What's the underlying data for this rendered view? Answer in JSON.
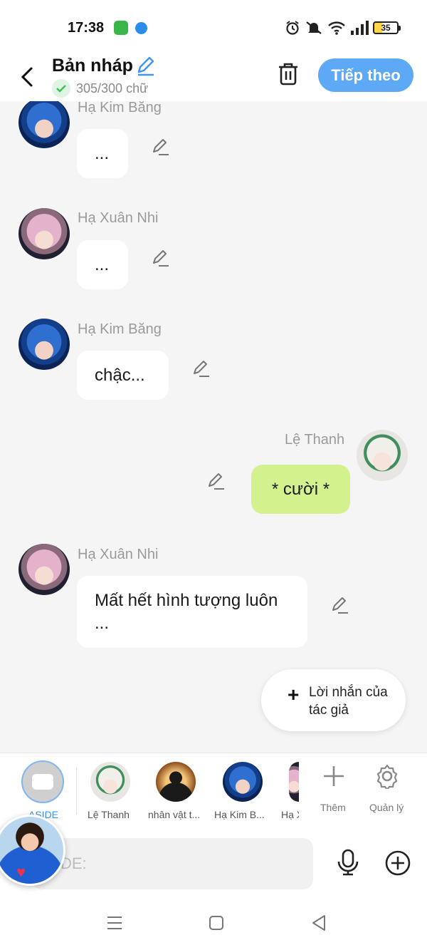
{
  "status_bar": {
    "time": "17:38",
    "battery": "35"
  },
  "header": {
    "title": "Bản nháp",
    "word_count": "305/300 chữ",
    "next_label": "Tiếp theo"
  },
  "messages": [
    {
      "sender": "Hạ Kim Băng",
      "text": "...",
      "side": "left",
      "avatar": "blue-hair-girl"
    },
    {
      "sender": "Hạ Xuân Nhi",
      "text": "...",
      "side": "left",
      "avatar": "pink-hair-girl"
    },
    {
      "sender": "Hạ Kim Băng",
      "text": "chậc...",
      "side": "left",
      "avatar": "blue-hair-girl"
    },
    {
      "sender": "Lệ Thanh",
      "text": "* cười *",
      "side": "right",
      "avatar": "white-hair-girl"
    },
    {
      "sender": "Hạ Xuân Nhi",
      "text": "Mất hết hình tượng luôn ...",
      "side": "left",
      "avatar": "pink-hair-girl"
    }
  ],
  "author_note": {
    "label": "Lời nhắn của tác giả"
  },
  "characters": {
    "aside_label": "ASIDE",
    "items": [
      {
        "name": "Lệ Thanh"
      },
      {
        "name": "nhân vật t..."
      },
      {
        "name": "Hạ Kim B..."
      },
      {
        "name": "Hạ X"
      }
    ],
    "add_label": "Thêm",
    "manage_label": "Quản lý"
  },
  "input": {
    "placeholder": "DE:"
  },
  "colors": {
    "accent": "#5ea9f6",
    "my_bubble": "#d3f28e",
    "background": "#f5f5f5"
  }
}
